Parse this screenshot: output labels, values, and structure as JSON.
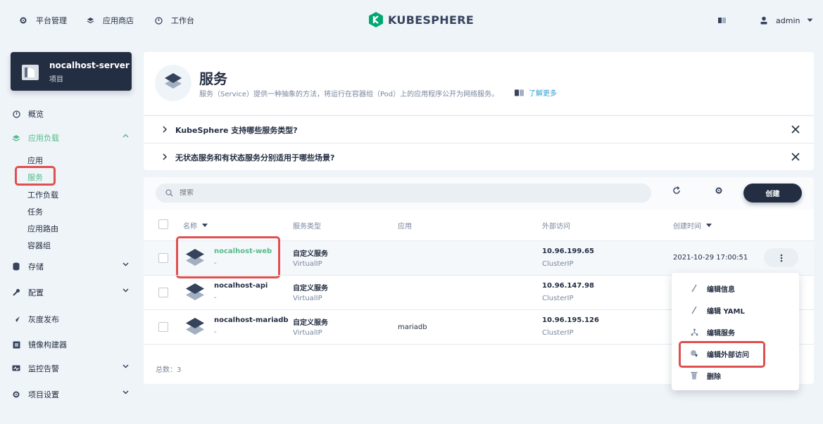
{
  "topnav": {
    "platform": "平台管理",
    "appstore": "应用商店",
    "workbench": "工作台",
    "brand": "KUBESPHERE",
    "user": "admin"
  },
  "project": {
    "name": "nocalhost-server",
    "type": "项目"
  },
  "sidebar": {
    "overview": "概览",
    "workloads": "应用负载",
    "sub": [
      "应用",
      "服务",
      "工作负载",
      "任务",
      "应用路由",
      "容器组"
    ],
    "storage": "存储",
    "config": "配置",
    "grayscale": "灰度发布",
    "imagebuilder": "镜像构建器",
    "monitoring": "监控告警",
    "settings": "项目设置"
  },
  "header": {
    "title": "服务",
    "desc": "服务（Service）提供一种抽象的方法，将运行在容器组（Pod）上的应用程序公开为网络服务。",
    "learn_more": "了解更多"
  },
  "faq": [
    "KubeSphere 支持哪些服务类型?",
    "无状态服务和有状态服务分别适用于哪些场景?"
  ],
  "toolbar": {
    "search_placeholder": "搜索",
    "create": "创建"
  },
  "table": {
    "headers": {
      "name": "名称",
      "type": "服务类型",
      "app": "应用",
      "external": "外部访问",
      "created": "创建时间"
    },
    "rows": [
      {
        "name": "nocalhost-web",
        "desc": "-",
        "type": "自定义服务",
        "subtype": "VirtualIP",
        "app": "",
        "ip": "10.96.199.65",
        "iptype": "ClusterIP",
        "created": "2021-10-29 17:00:51"
      },
      {
        "name": "nocalhost-api",
        "desc": "-",
        "type": "自定义服务",
        "subtype": "VirtualIP",
        "app": "",
        "ip": "10.96.147.98",
        "iptype": "ClusterIP",
        "created": ""
      },
      {
        "name": "nocalhost-mariadb",
        "desc": "-",
        "type": "自定义服务",
        "subtype": "VirtualIP",
        "app": "mariadb",
        "ip": "10.96.195.126",
        "iptype": "ClusterIP",
        "created": ""
      }
    ],
    "total": "总数：3"
  },
  "menu": [
    "编辑信息",
    "编辑 YAML",
    "编辑服务",
    "编辑外部访问",
    "删除"
  ],
  "colors": {
    "accent": "#55bc8a",
    "dark": "#242e42",
    "highlight": "#e04f4f",
    "link": "#329dce"
  }
}
